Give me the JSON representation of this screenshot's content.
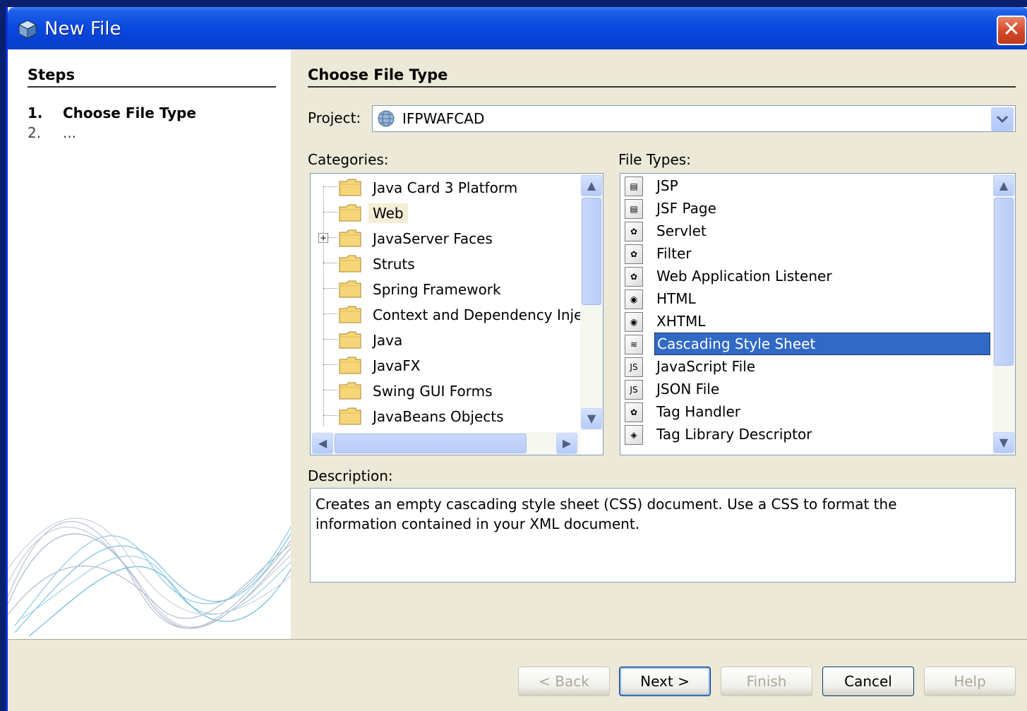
{
  "window": {
    "title": "New File",
    "close_glyph": "✕"
  },
  "steps": {
    "title": "Steps",
    "items": [
      {
        "num": "1.",
        "label": "Choose File Type"
      },
      {
        "num": "2.",
        "label": "..."
      }
    ]
  },
  "main": {
    "title": "Choose File Type",
    "project_label": "Project:",
    "project_value": "IFPWAFCAD",
    "categories_label": "Categories:",
    "categories": [
      "Java Card 3 Platform",
      "Web",
      "JavaServer Faces",
      "Struts",
      "Spring Framework",
      "Context and Dependency Inje",
      "Java",
      "JavaFX",
      "Swing GUI Forms",
      "JavaBeans Objects"
    ],
    "selected_category": "Web",
    "file_types_label": "File Types:",
    "file_types": [
      {
        "label": "JSP",
        "icon": "jsp-file-icon"
      },
      {
        "label": "JSF Page",
        "icon": "jsf-page-icon"
      },
      {
        "label": "Servlet",
        "icon": "servlet-icon"
      },
      {
        "label": "Filter",
        "icon": "filter-icon"
      },
      {
        "label": "Web Application Listener",
        "icon": "listener-icon"
      },
      {
        "label": "HTML",
        "icon": "html-file-icon"
      },
      {
        "label": "XHTML",
        "icon": "xhtml-file-icon"
      },
      {
        "label": "Cascading Style Sheet",
        "icon": "css-file-icon"
      },
      {
        "label": "JavaScript File",
        "icon": "javascript-file-icon"
      },
      {
        "label": "JSON File",
        "icon": "json-file-icon"
      },
      {
        "label": "Tag Handler",
        "icon": "tag-handler-icon"
      },
      {
        "label": "Tag Library Descriptor",
        "icon": "tag-library-icon"
      }
    ],
    "selected_file_type": "Cascading Style Sheet",
    "description_label": "Description:",
    "description": "Creates an empty cascading style sheet (CSS) document. Use a CSS to format the information contained in your XML document."
  },
  "buttons": {
    "back": "< Back",
    "next": "Next >",
    "finish": "Finish",
    "cancel": "Cancel",
    "help": "Help"
  },
  "colors": {
    "titlebar": "#0a4be0",
    "selection": "#316ac5",
    "dialog_bg": "#ece9d8"
  }
}
